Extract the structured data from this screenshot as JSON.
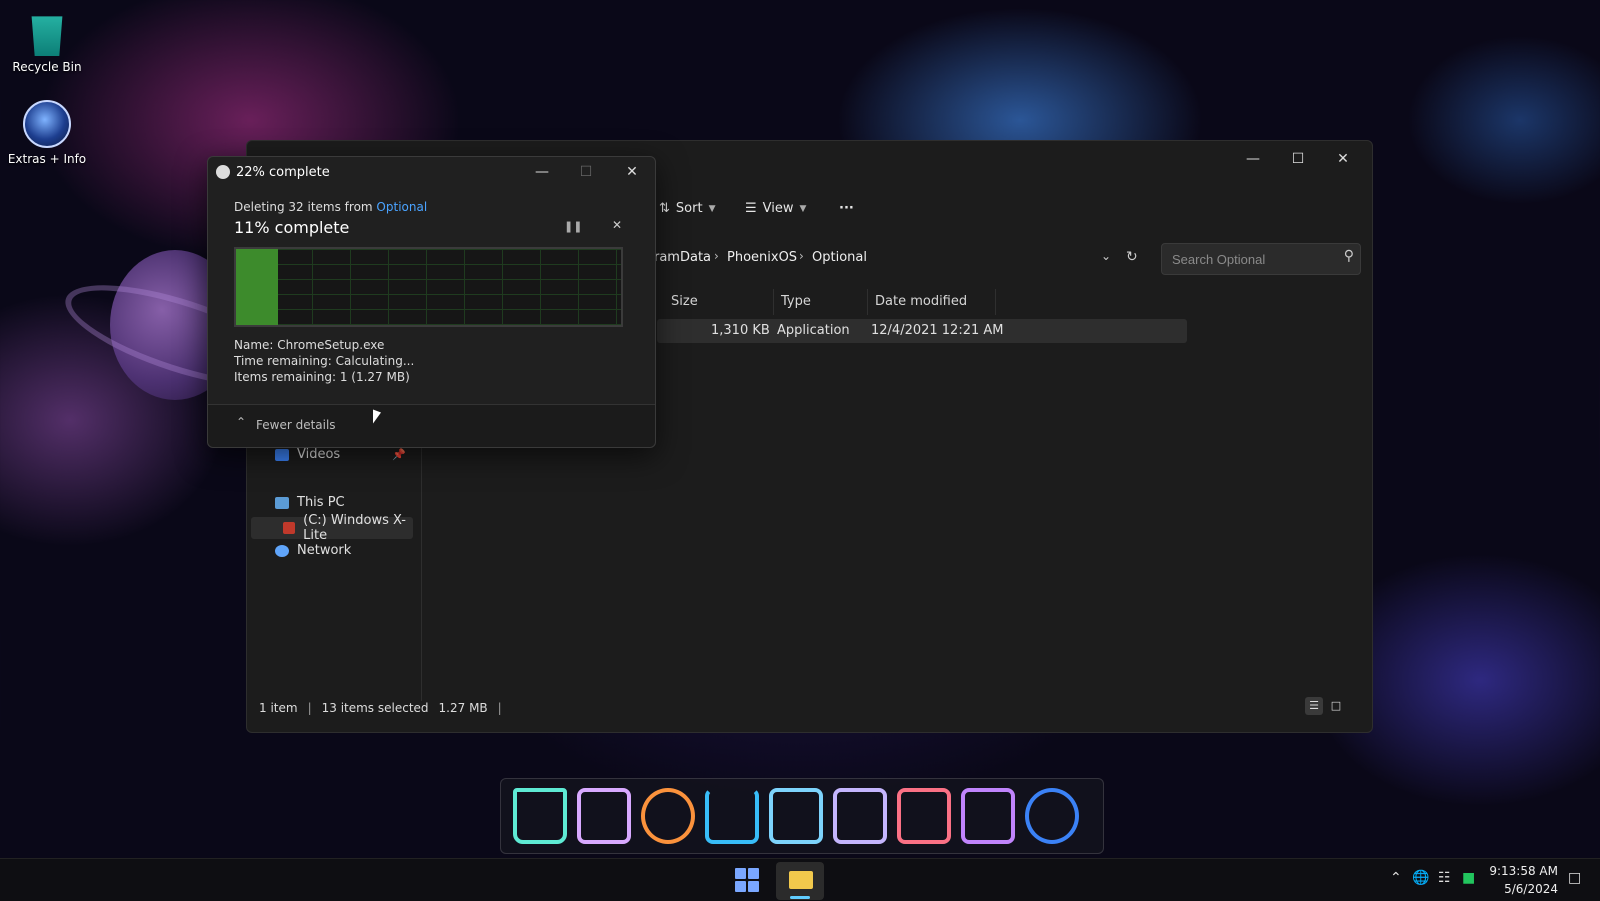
{
  "desktop": {
    "icons": [
      {
        "label": "Recycle Bin",
        "icon": "recycle-bin-icon"
      },
      {
        "label": "Extras + Info",
        "icon": "globe-icon"
      }
    ]
  },
  "explorer": {
    "toolbar": {
      "sort_label": "Sort",
      "view_label": "View",
      "more_label": "···"
    },
    "breadcrumb": [
      "ramData",
      "PhoenixOS",
      "Optional"
    ],
    "search_placeholder": "Search Optional",
    "columns": [
      "Size",
      "Type",
      "Date modified"
    ],
    "rows": [
      {
        "size": "1,310 KB",
        "type": "Application",
        "date": "12/4/2021 12:21 AM"
      }
    ],
    "nav": [
      {
        "label": "Videos",
        "icon": "videos-icon"
      },
      {
        "label": "This PC",
        "icon": "computer-icon"
      },
      {
        "label": "(C:) Windows X-Lite",
        "icon": "drive-icon"
      },
      {
        "label": "Network",
        "icon": "network-icon"
      }
    ],
    "status": {
      "count": "1 item",
      "selected": "13 items selected",
      "size": "1.27 MB"
    }
  },
  "dialog": {
    "title": "22% complete",
    "deleting_prefix": "Deleting 32 items from ",
    "deleting_source": "Optional",
    "progress_label": "11% complete",
    "progress_fraction": 0.11,
    "name": "Name:  ChromeSetup.exe",
    "time_remaining": "Time remaining:  Calculating...",
    "items_remaining": "Items remaining:  1 (1.27 MB)",
    "fewer_details": "Fewer details"
  },
  "dock": [
    "trash-icon",
    "monitor-icon",
    "settings-icon",
    "download-icon",
    "info-icon",
    "list-icon",
    "video-icon",
    "camera-icon",
    "music-icon"
  ],
  "taskbar": {
    "time": "9:13:58 AM",
    "date": "5/6/2024"
  },
  "colors": {
    "progress": "#3d8b2c",
    "accent": "#4aa3ff"
  }
}
